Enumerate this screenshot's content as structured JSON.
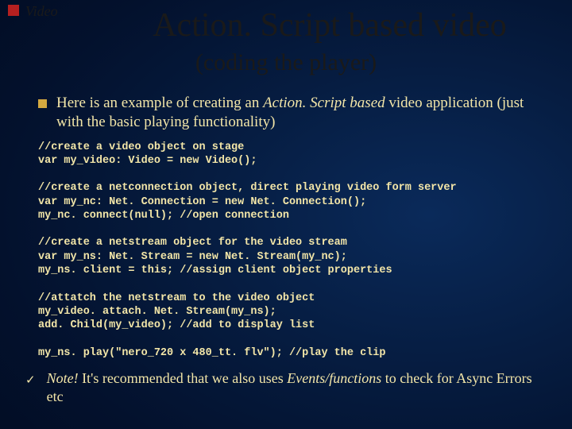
{
  "top": {
    "label": "Video"
  },
  "title": "Action. Script based video",
  "subtitle": "(coding the player)",
  "bullet": {
    "lead": "Here is an example of creating an ",
    "em": "Action. Script based",
    "tail": " video application (just with the basic playing functionality)"
  },
  "code": "//create a video object on stage\nvar my_video: Video = new Video();\n\n//create a netconnection object, direct playing video form server\nvar my_nc: Net. Connection = new Net. Connection();\nmy_nc. connect(null); //open connection\n\n//create a netstream object for the video stream\nvar my_ns: Net. Stream = new Net. Stream(my_nc);\nmy_ns. client = this; //assign client object properties\n\n//attatch the netstream to the video object\nmy_video. attach. Net. Stream(my_ns);\nadd. Child(my_video); //add to display list\n\nmy_ns. play(\"nero_720 x 480_tt. flv\"); //play the clip",
  "note": {
    "nb": "Note!",
    "mid": " It's recommended that we also uses ",
    "emf": "Events/functions",
    "end": " to check for Async Errors etc"
  }
}
